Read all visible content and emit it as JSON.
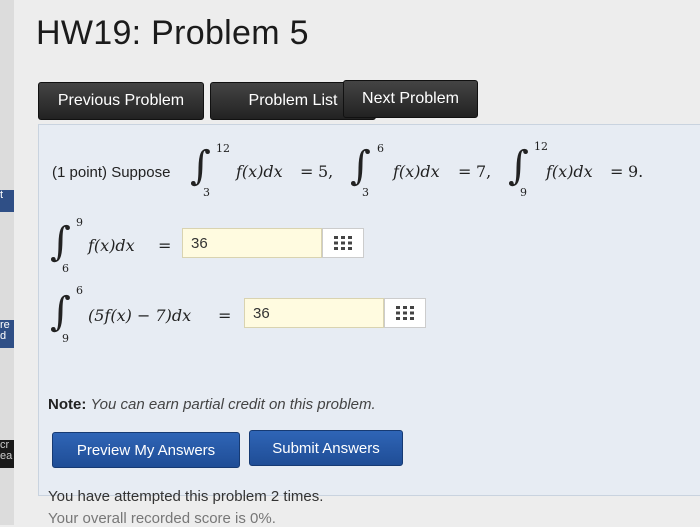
{
  "page": {
    "title": "HW19: Problem 5"
  },
  "nav": {
    "previous": "Previous Problem",
    "list": "Problem List",
    "next": "Next Problem"
  },
  "problem": {
    "intro": "(1 point) Suppose",
    "given": [
      {
        "lower": "3",
        "upper": "12",
        "integrand": "f(x)dx",
        "rhs": "5,"
      },
      {
        "lower": "3",
        "upper": "6",
        "integrand": "f(x)dx",
        "rhs": "7,"
      },
      {
        "lower": "9",
        "upper": "12",
        "integrand": "f(x)dx",
        "rhs": "9."
      }
    ],
    "questions": [
      {
        "lower": "6",
        "upper": "9",
        "integrand": "f(x)dx",
        "answer": "36"
      },
      {
        "lower": "9",
        "upper": "6",
        "integrand": "(5f(x) − 7)dx",
        "answer": "36"
      }
    ],
    "eq_sign": "=",
    "matrix_icon": "grid-icon"
  },
  "note": {
    "label": "Note:",
    "text": "You can earn partial credit on this problem."
  },
  "actions": {
    "preview": "Preview My Answers",
    "submit": "Submit Answers"
  },
  "status": {
    "attempts": "You have attempted this problem 2 times.",
    "score": "Your overall recorded score is 0%."
  },
  "sidebar": {
    "tabs": [
      "t",
      "re\nd",
      "cr\nea"
    ]
  }
}
